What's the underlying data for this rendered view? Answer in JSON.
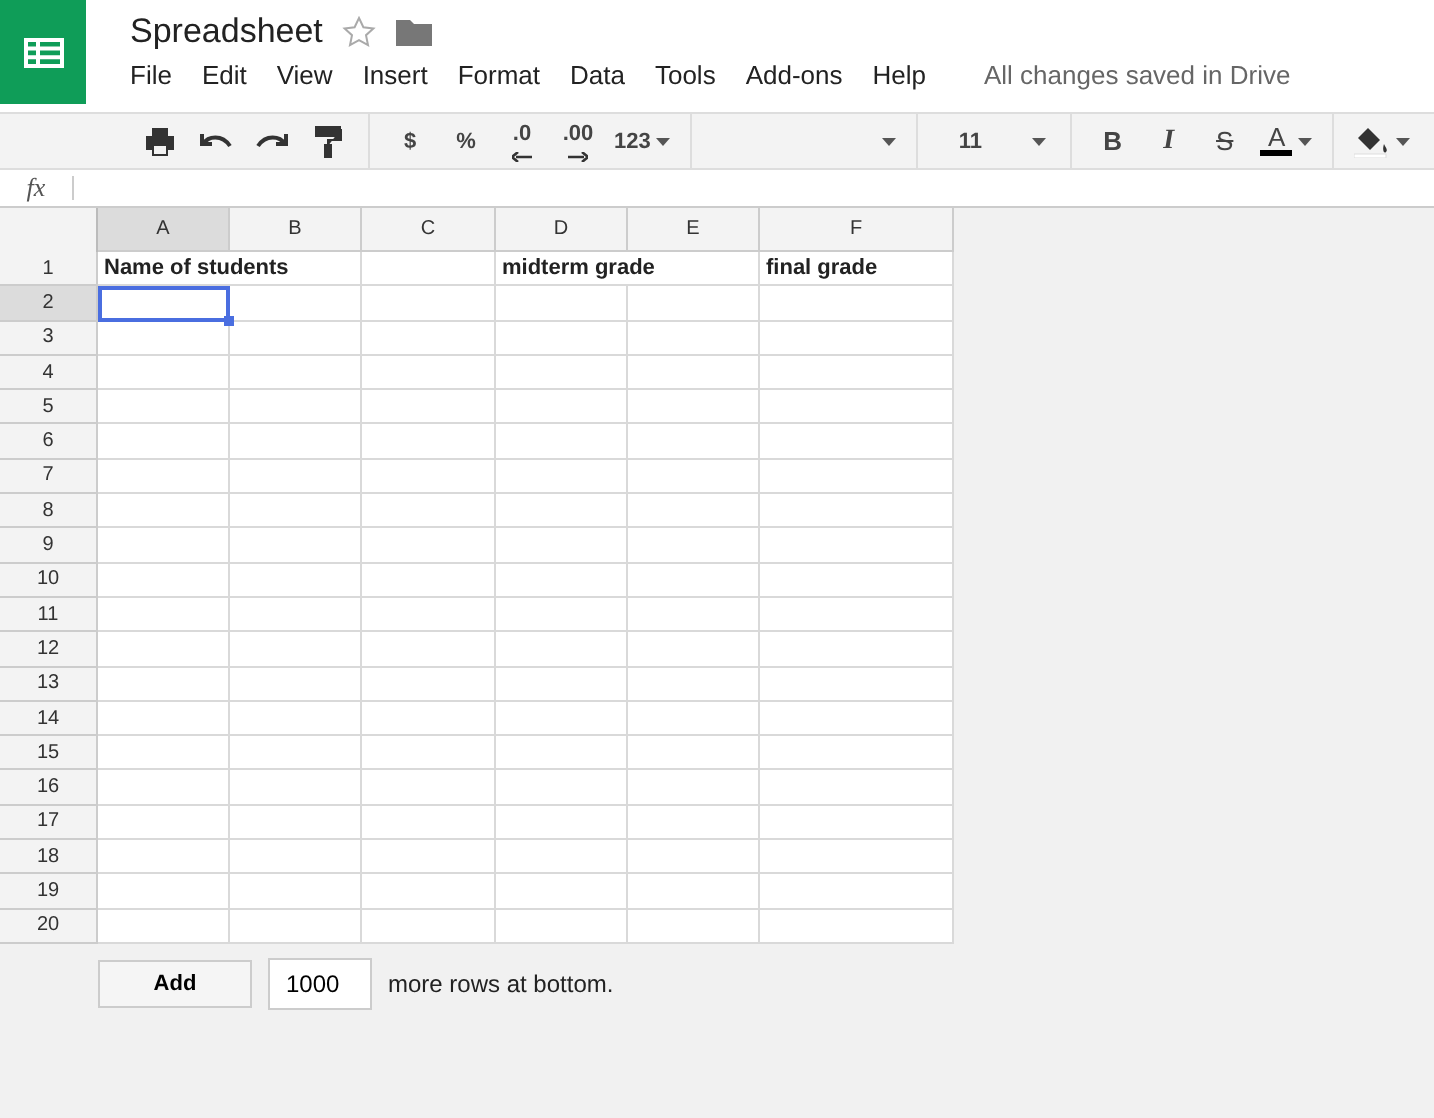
{
  "document": {
    "title": "Spreadsheet",
    "starred": false
  },
  "menu": [
    "File",
    "Edit",
    "View",
    "Insert",
    "Format",
    "Data",
    "Tools",
    "Add-ons",
    "Help"
  ],
  "save_status": "All changes saved in Drive",
  "toolbar": [
    {
      "items": [
        {
          "kind": "print"
        },
        {
          "kind": "undo"
        },
        {
          "kind": "redo"
        },
        {
          "kind": "paint-format"
        }
      ]
    },
    {
      "items": [
        {
          "kind": "text",
          "label": "$"
        },
        {
          "kind": "text",
          "label": "%"
        },
        {
          "kind": "decimal-less",
          "label": ".0"
        },
        {
          "kind": "decimal-more",
          "label": ".00"
        },
        {
          "kind": "dropdown",
          "label": "123"
        }
      ]
    },
    {
      "items": [
        {
          "kind": "font-dropdown"
        }
      ]
    },
    {
      "items": [
        {
          "kind": "size-dropdown",
          "label": "11"
        }
      ]
    },
    {
      "items": [
        {
          "kind": "bold",
          "label": "B"
        },
        {
          "kind": "italic",
          "label": "I"
        },
        {
          "kind": "strike",
          "label": "S"
        },
        {
          "kind": "text-color",
          "label": "A"
        }
      ]
    },
    {
      "items": [
        {
          "kind": "fill-color"
        }
      ]
    }
  ],
  "formula_bar": {
    "label": "fx"
  },
  "columns": [
    {
      "label": "A",
      "selected": true
    },
    {
      "label": "B",
      "selected": false
    },
    {
      "label": "C",
      "selected": false
    },
    {
      "label": "D",
      "selected": false
    },
    {
      "label": "E",
      "selected": false
    },
    {
      "label": "F",
      "selected": false
    }
  ],
  "rows": [
    {
      "label": "1",
      "selected": false,
      "cells": [
        {
          "text": "Name of students"
        },
        {},
        {},
        {
          "text": "midterm grade"
        },
        {},
        {
          "text": "final grade"
        }
      ]
    },
    {
      "label": "2",
      "selected": true
    },
    {
      "label": "3",
      "selected": false
    },
    {
      "label": "4",
      "selected": false
    },
    {
      "label": "5",
      "selected": false
    },
    {
      "label": "6",
      "selected": false
    },
    {
      "label": "7",
      "selected": false
    },
    {
      "label": "8",
      "selected": false
    },
    {
      "label": "9",
      "selected": false
    },
    {
      "label": "10",
      "selected": false
    },
    {
      "label": "11",
      "selected": false
    },
    {
      "label": "12",
      "selected": false
    },
    {
      "label": "13",
      "selected": false
    },
    {
      "label": "14",
      "selected": false
    },
    {
      "label": "15",
      "selected": false
    },
    {
      "label": "16",
      "selected": false
    },
    {
      "label": "17",
      "selected": false
    },
    {
      "label": "18",
      "selected": false
    },
    {
      "label": "19",
      "selected": false
    },
    {
      "label": "20",
      "selected": false
    }
  ],
  "add_rows": {
    "button": "Add",
    "value": "1000",
    "suffix": "more rows at bottom."
  }
}
